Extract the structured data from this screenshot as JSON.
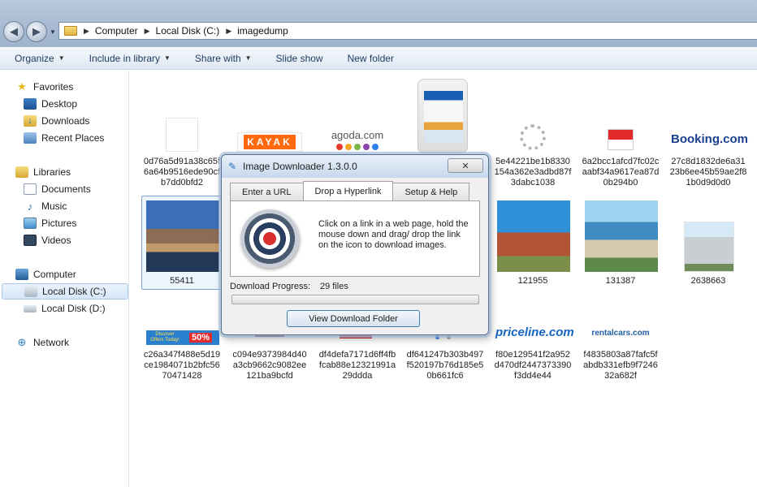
{
  "address": {
    "crumbs": [
      "Computer",
      "Local Disk (C:)",
      "imagedump"
    ]
  },
  "toolbar": {
    "organize": "Organize",
    "include_in_library": "Include in library",
    "share_with": "Share with",
    "slide_show": "Slide show",
    "new_folder": "New folder"
  },
  "sidebar": {
    "favorites": "Favorites",
    "desktop": "Desktop",
    "downloads": "Downloads",
    "recent_places": "Recent Places",
    "libraries": "Libraries",
    "documents": "Documents",
    "music": "Music",
    "pictures": "Pictures",
    "videos": "Videos",
    "computer": "Computer",
    "local_c": "Local Disk (C:)",
    "local_d": "Local Disk (D:)",
    "network": "Network"
  },
  "files": {
    "r1": [
      "0d76a5d91a38c65f6a64b9516ede90cfb7dd0bfd2",
      "",
      "",
      "",
      "5e44221be1b8330154a362e3adbd87f3dabc1038",
      "6a2bcc1afcd7fc02caabf34a9617ea87d0b294b0",
      "27c8d1832de6a3123b6ee45b59ae2f81b0d9d0d0"
    ],
    "r2": [
      "55411",
      "",
      "",
      "",
      "121955",
      "131387",
      "2638663"
    ],
    "r3": [
      "c26a347f488e5d19ce1984071b2bfc5670471428",
      "c094e9373984d40a3cb9662c9082ee121ba9bcfd",
      "df4defa7171d6ff4fbfcab88e12321991a29ddda",
      "df641247b303b497f520197b76d185e50b661fc6",
      "f80e129541f2a952d470df2447373390f3dd4e44",
      "f4835803a87fafc5fabdb331efb9f724632a682f"
    ],
    "logos": {
      "kayak": "KAYAK",
      "agoda": "agoda.com",
      "booking": "Booking.com",
      "priceline": "priceline.com",
      "rentalcars": "rentalcars.com",
      "discover": "Discover Offers Today!",
      "fifty": "50%"
    }
  },
  "dialog": {
    "title": "Image Downloader 1.3.0.0",
    "close": "✕",
    "tabs": [
      "Enter a URL",
      "Drop a Hyperlink",
      "Setup & Help"
    ],
    "instructions": "Click on a link in a web page, hold the mouse down and drag/ drop the link on the icon to download images.",
    "progress_label": "Download Progress:",
    "progress_value": "29 files",
    "view_button": "View Download Folder"
  },
  "colors": {
    "accent": "#3c7fb1",
    "booking": "#1a3f8f",
    "kayak": "#ff690f"
  }
}
